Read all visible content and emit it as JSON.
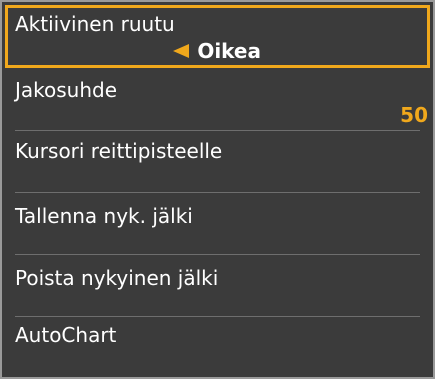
{
  "colors": {
    "background": "#3b3b3b",
    "accent": "#f0a81c",
    "text": "#ffffff",
    "divider": "#6e6e6e"
  },
  "menu": {
    "items": [
      {
        "label": "Aktiivinen ruutu",
        "value": "Oikea",
        "value_icon": "left-arrow-icon",
        "selected": true
      },
      {
        "label": "Jakosuhde",
        "value": "50"
      },
      {
        "label": "Kursori reittipisteelle"
      },
      {
        "label": "Tallenna nyk. jälki"
      },
      {
        "label": "Poista nykyinen jälki"
      },
      {
        "label": "AutoChart"
      }
    ]
  }
}
